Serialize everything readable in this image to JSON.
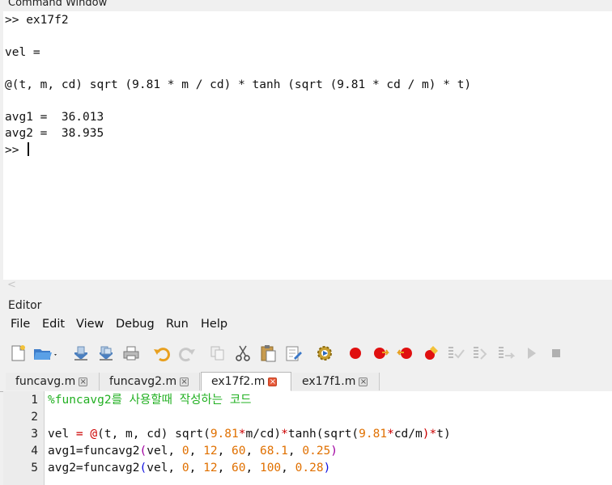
{
  "command_window": {
    "title": "Command Window",
    "lines": [
      ">> ex17f2",
      "",
      "vel =",
      "",
      "@(t, m, cd) sqrt (9.81 * m / cd) * tanh (sqrt (9.81 * cd / m) * t)",
      "",
      "avg1 =  36.013",
      "avg2 =  38.935"
    ],
    "prompt": ">> "
  },
  "editor": {
    "title": "Editor",
    "menu": [
      "File",
      "Edit",
      "View",
      "Debug",
      "Run",
      "Help"
    ],
    "tabs": [
      {
        "label": "funcavg.m",
        "active": false
      },
      {
        "label": "funcavg2.m",
        "active": false
      },
      {
        "label": "ex17f2.m",
        "active": true
      },
      {
        "label": "ex17f1.m",
        "active": false
      }
    ],
    "line_numbers": [
      "1",
      "2",
      "3",
      "4",
      "5"
    ],
    "code": {
      "line1": "%funcavg2를 사용할때 작성하는 코드",
      "line3": {
        "a": "vel ",
        "b": "= @",
        "c": "(t, m, cd) sqrt(",
        "d": "9.81",
        "e": "*",
        "f": "m/cd",
        "g": ")",
        "h": "*",
        "i": "tanh(sqrt(",
        "j": "9.81",
        "k": "*",
        "l": "cd/m",
        "m": ")*",
        "n": "t",
        "o": ")"
      },
      "line4": {
        "a": "avg1=funcavg2",
        "b": "(",
        "c": "vel, ",
        "d": "0",
        "e": ", ",
        "f": "12",
        "g": ", ",
        "h": "60",
        "i": ", ",
        "j": "68.1",
        "k": ", ",
        "l": "0.25",
        "m": ")"
      },
      "line5": {
        "a": "avg2=funcavg2",
        "b": "(",
        "c": "vel, ",
        "d": "0",
        "e": ", ",
        "f": "12",
        "g": ", ",
        "h": "60",
        "i": ", ",
        "j": "100",
        "k": ", ",
        "l": "0.28",
        "m": ")"
      }
    }
  },
  "colors": {
    "comment": "#22b022",
    "operator": "#cc0000",
    "number": "#e07000",
    "bracket_alt": "#a000a0",
    "bracket": "#1010e0"
  },
  "toolbar_icons": [
    "new-file-icon",
    "open-folder-icon",
    "save-icon",
    "save-all-icon",
    "print-icon",
    "undo-icon",
    "redo-icon",
    "copy-icon",
    "cut-icon",
    "paste-icon",
    "find-replace-icon",
    "run-settings-icon",
    "toggle-breakpoint-icon",
    "next-breakpoint-icon",
    "previous-breakpoint-icon",
    "remove-all-breakpoints-icon",
    "step-over-icon",
    "step-in-icon",
    "step-out-icon",
    "continue-icon",
    "stop-icon"
  ]
}
